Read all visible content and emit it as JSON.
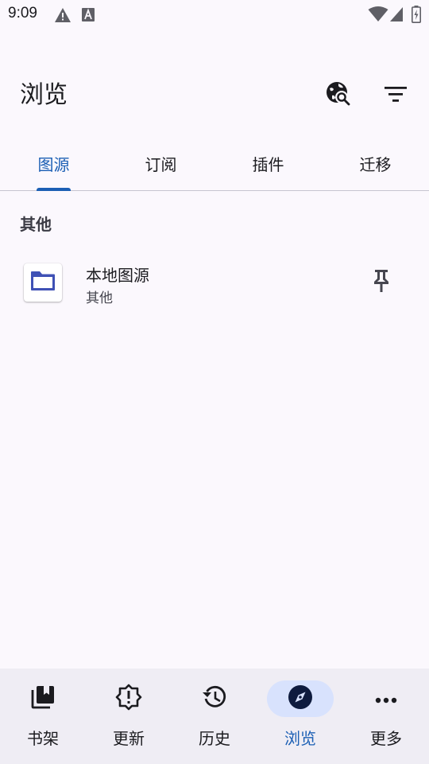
{
  "status_bar": {
    "time": "9:09",
    "icons": [
      "warning-icon",
      "text-a-icon",
      "wifi-icon",
      "signal-icon",
      "battery-charging-icon"
    ]
  },
  "app_bar": {
    "title": "浏览",
    "actions": [
      "globe-search-icon",
      "filter-icon"
    ]
  },
  "tabs": [
    {
      "label": "图源",
      "active": true
    },
    {
      "label": "订阅",
      "active": false
    },
    {
      "label": "插件",
      "active": false
    },
    {
      "label": "迁移",
      "active": false
    }
  ],
  "sections": [
    {
      "header": "其他",
      "items": [
        {
          "name": "本地图源",
          "subtitle": "其他",
          "icon": "folder-icon",
          "pin_icon": "pin-icon"
        }
      ]
    }
  ],
  "bottom_nav": [
    {
      "label": "书架",
      "icon": "library-icon",
      "active": false
    },
    {
      "label": "更新",
      "icon": "alert-badge-icon",
      "active": false
    },
    {
      "label": "历史",
      "icon": "history-icon",
      "active": false
    },
    {
      "label": "浏览",
      "icon": "compass-icon",
      "active": true
    },
    {
      "label": "更多",
      "icon": "more-horizontal-icon",
      "active": false
    }
  ],
  "colors": {
    "background": "#fbf8fd",
    "primary": "#1b5fb4",
    "nav_background": "#efedf4",
    "nav_active_pill": "#d8e2fd",
    "folder_icon": "#3f51b5",
    "text": "#1b1b1f"
  }
}
